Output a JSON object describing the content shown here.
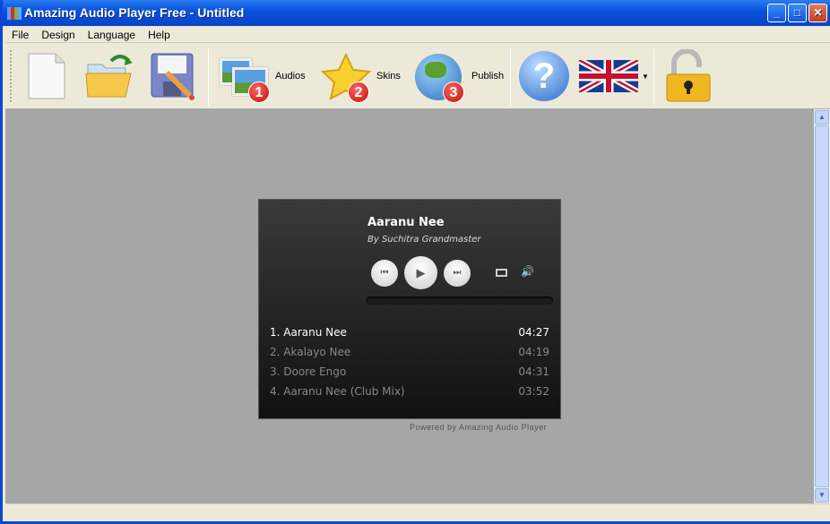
{
  "window": {
    "title": "Amazing Audio Player Free - Untitled"
  },
  "menu": [
    "File",
    "Design",
    "Language",
    "Help"
  ],
  "toolbar": {
    "new_icon": "new-document-icon",
    "open_icon": "open-folder-icon",
    "save_icon": "save-icon",
    "audios": {
      "label": "Audios",
      "badge": "1"
    },
    "skins": {
      "label": "Skins",
      "badge": "2"
    },
    "publish": {
      "label": "Publish",
      "badge": "3"
    },
    "help_icon": "help-icon",
    "language_icon": "uk-flag-icon",
    "lock_icon": "unlock-icon"
  },
  "player": {
    "title": "Aaranu Nee",
    "artist": "By Suchitra Grandmaster",
    "progress": 0,
    "tracks": [
      {
        "name": "1. Aaranu Nee",
        "duration": "04:27"
      },
      {
        "name": "2. Akalayo Nee",
        "duration": "04:19"
      },
      {
        "name": "3. Doore Engo",
        "duration": "04:31"
      },
      {
        "name": "4. Aaranu Nee (Club Mix)",
        "duration": "03:52"
      }
    ],
    "powered": "Powered by Amazing Audio Player"
  }
}
